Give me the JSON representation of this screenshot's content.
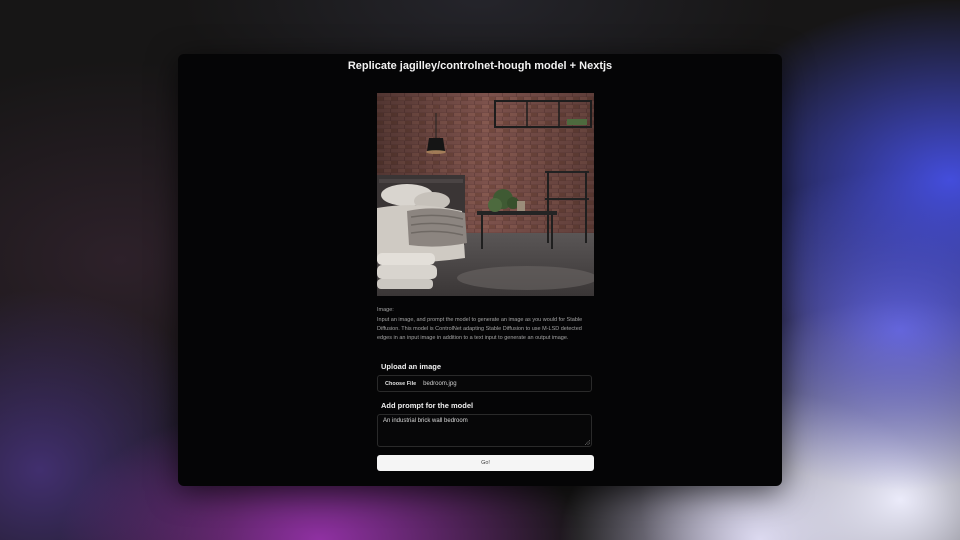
{
  "page": {
    "title": "Replicate jagilley/controlnet-hough model + Nextjs"
  },
  "preview": {
    "icon": "generated-bedroom-image"
  },
  "form": {
    "image_label": "Image:",
    "description": "Input an image, and prompt the model to generate an image as you would for Stable Diffusion. This model is ControlNet adapting Stable Diffusion to use M-LSD detected edges in an input image in addition to a text input to generate an output image.",
    "upload_label": "Upload an image",
    "choose_file_label": "Choose File",
    "file_name": "bedroom.jpg",
    "prompt_label": "Add prompt for the model",
    "prompt_value": "An industrial brick wall bedroom",
    "submit_label": "Go!"
  },
  "colors": {
    "window_bg": "#050506",
    "button_bg": "#f5f5f5",
    "accent_blue": "#4650e6",
    "accent_purple": "#9632aa"
  }
}
